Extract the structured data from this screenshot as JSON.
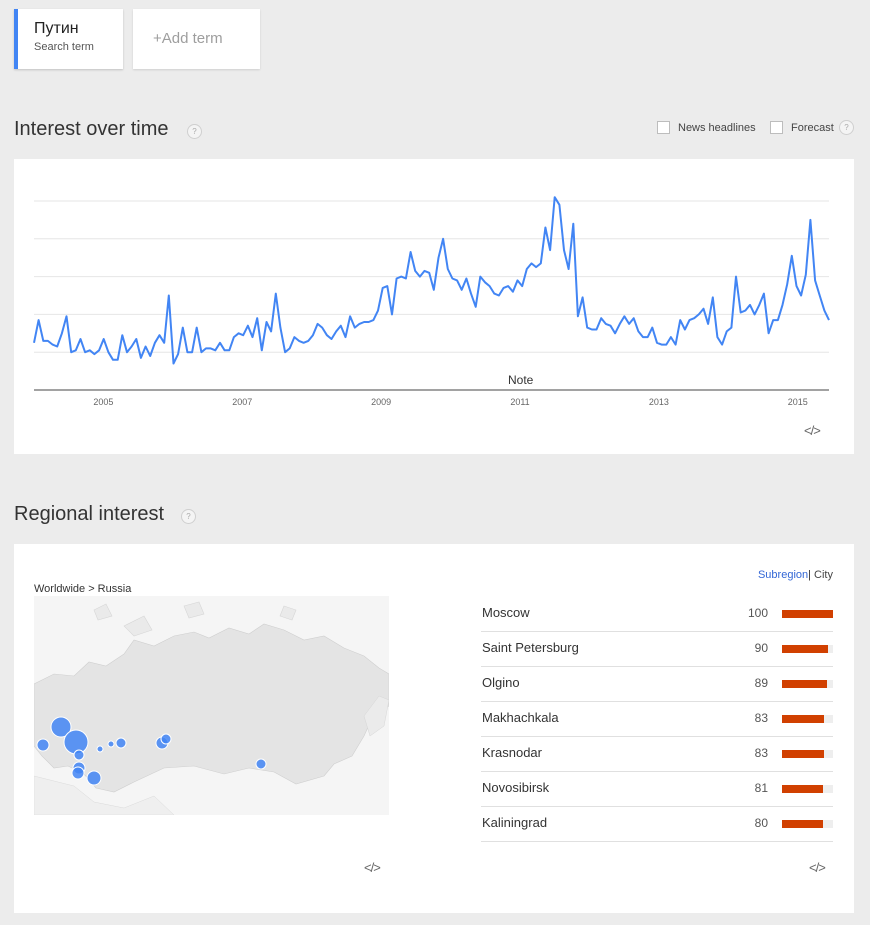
{
  "search_term": {
    "name": "Путин",
    "sub": "Search term"
  },
  "add_term": "+Add term",
  "interest_over_time": {
    "title": "Interest over time",
    "help": "?",
    "news_headlines": "News headlines",
    "forecast": "Forecast",
    "note": "Note",
    "embed": "</>"
  },
  "chart_data": {
    "type": "line",
    "x_ticks": [
      "2005",
      "2007",
      "2009",
      "2011",
      "2013",
      "2015"
    ],
    "x_range": [
      2004.0,
      2015.45
    ],
    "ylim": [
      0,
      100
    ],
    "grid": true,
    "series": [
      {
        "values": [
          25,
          37,
          26,
          26,
          24,
          23,
          30,
          39,
          20,
          21,
          27,
          20,
          21,
          19,
          21,
          27,
          20,
          16,
          16,
          29,
          20,
          23,
          27,
          17,
          23,
          18,
          25,
          29,
          25,
          50,
          14,
          19,
          33,
          20,
          20,
          33,
          20,
          22,
          22,
          21,
          25,
          21,
          21,
          28,
          30,
          29,
          34,
          28,
          38,
          21,
          36,
          31,
          51,
          33,
          20,
          22,
          28,
          26,
          25,
          26,
          29,
          35,
          33,
          29,
          27,
          31,
          34,
          28,
          39,
          33,
          35,
          36,
          36,
          37,
          42,
          54,
          55,
          40,
          59,
          60,
          59,
          73,
          63,
          60,
          63,
          62,
          53,
          70,
          80,
          64,
          59,
          58,
          53,
          59,
          51,
          44,
          60,
          57,
          55,
          51,
          50,
          54,
          55,
          52,
          58,
          55,
          64,
          67,
          65,
          67,
          86,
          74,
          102,
          98,
          74,
          64,
          88,
          39,
          49,
          33,
          32,
          32,
          38,
          35,
          34,
          30,
          35,
          39,
          35,
          38,
          31,
          28,
          28,
          33,
          25,
          24,
          24,
          28,
          24,
          37,
          32,
          37,
          38,
          40,
          43,
          35,
          49,
          28,
          24,
          31,
          33,
          60,
          41,
          42,
          45,
          40,
          45,
          51,
          30,
          37,
          37,
          45,
          56,
          71,
          55,
          50,
          61,
          90,
          58,
          50,
          42,
          37
        ]
      }
    ]
  },
  "regional_interest": {
    "title": "Regional interest",
    "help": "?",
    "breadcrumb": "Worldwide > Russia",
    "tabs": {
      "subregion": "Subregion",
      "separator": "|",
      "city": "City"
    },
    "embed_map": "</>",
    "embed_list": "</>",
    "rows": [
      {
        "name": "Moscow",
        "value": 100
      },
      {
        "name": "Saint Petersburg",
        "value": 90
      },
      {
        "name": "Olgino",
        "value": 89
      },
      {
        "name": "Makhachkala",
        "value": 83
      },
      {
        "name": "Krasnodar",
        "value": 83
      },
      {
        "name": "Novosibirsk",
        "value": 81
      },
      {
        "name": "Kaliningrad",
        "value": 80
      }
    ]
  },
  "colors": {
    "accent": "#4285f4",
    "bar": "#d14000",
    "line": "#4285f4"
  }
}
